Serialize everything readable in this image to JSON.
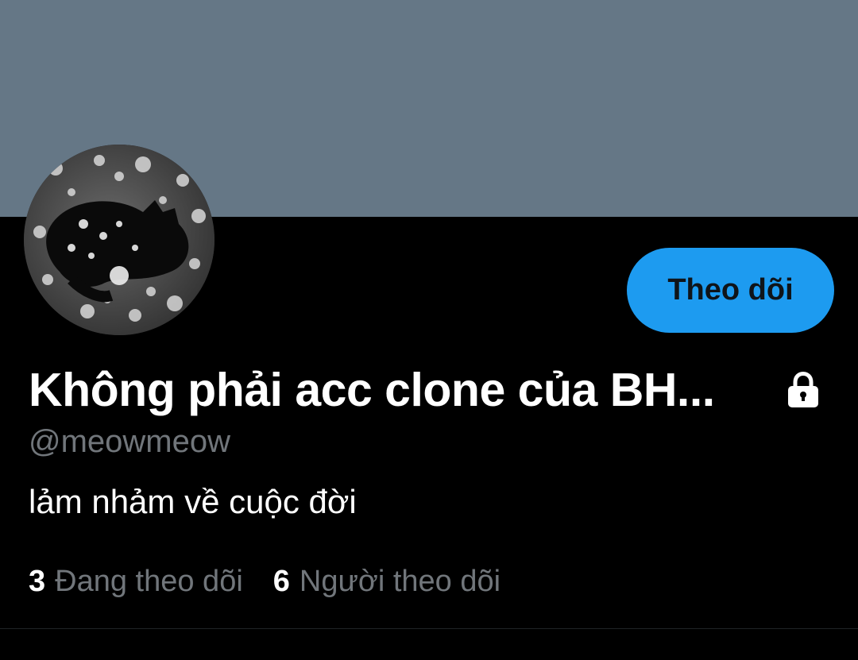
{
  "profile": {
    "display_name": "Không phải acc clone của BH...",
    "handle": "@meowmeow",
    "bio": "lảm nhảm về cuộc đời",
    "protected_icon": "lock-icon",
    "avatar_icon": "cat-photo"
  },
  "actions": {
    "follow_label": "Theo dõi"
  },
  "stats": {
    "following_count": "3",
    "following_label": "Đang theo dõi",
    "followers_count": "6",
    "followers_label": "Người theo dõi"
  },
  "colors": {
    "banner": "#657786",
    "background": "#000000",
    "accent": "#1d9bf0",
    "secondary_text": "#71767b"
  }
}
